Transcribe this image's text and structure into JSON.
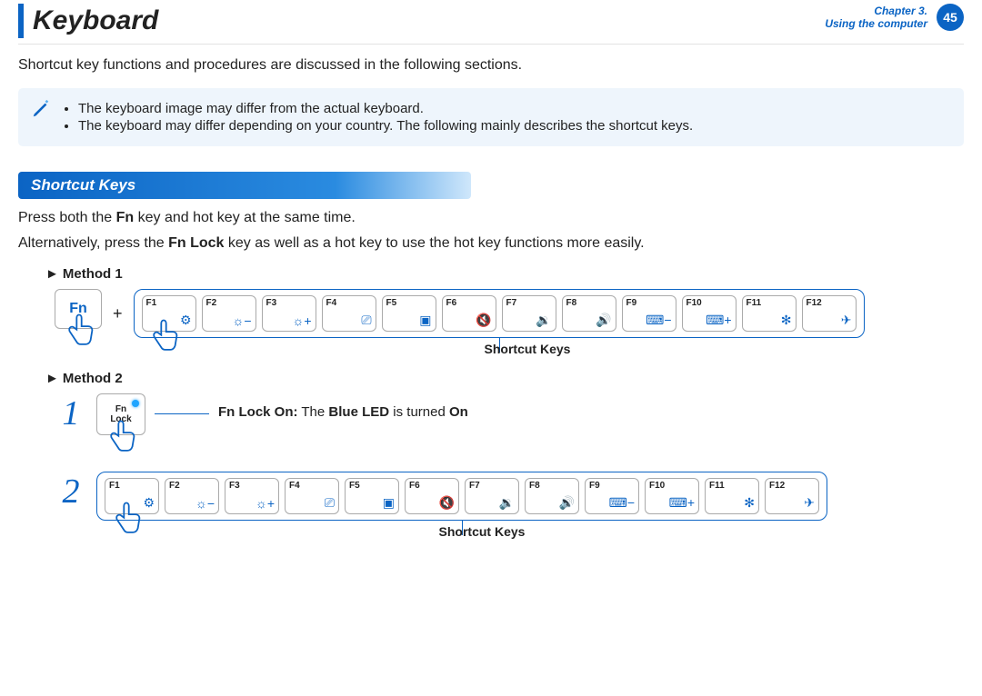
{
  "header": {
    "title": "Keyboard",
    "chapter_line": "Chapter 3.",
    "subtitle_line": "Using the computer",
    "page_number": "45"
  },
  "intro": "Shortcut key functions and procedures are discussed in the following sections.",
  "note": {
    "items": [
      "The keyboard image may differ from the actual keyboard.",
      "The keyboard may differ depending on your country. The following mainly describes the shortcut keys."
    ]
  },
  "section": {
    "heading": "Shortcut Keys",
    "desc_prefix": "Press both the ",
    "desc_bold1": "Fn",
    "desc_mid": " key and hot key at the same time.",
    "alt_prefix": "Alternatively, press the ",
    "alt_bold": "Fn Lock",
    "alt_suffix": " key as well as a hot key to use the hot key functions more easily."
  },
  "method1": {
    "label": "Method 1",
    "fn_text": "Fn",
    "plus": "+",
    "strip_caption": "Shortcut Keys"
  },
  "method2": {
    "label": "Method 2",
    "num1": "1",
    "num2": "2",
    "fnlock_text": "Fn\nLock",
    "fnlock_msg_bold1": "Fn Lock On:",
    "fnlock_msg_mid": " The ",
    "fnlock_msg_bold2": "Blue LED",
    "fnlock_msg_mid2": " is turned ",
    "fnlock_msg_bold3": "On",
    "strip_caption": "Shortcut Keys"
  },
  "fkeys": [
    {
      "label": "F1",
      "icon": "⚙"
    },
    {
      "label": "F2",
      "icon": "☼−"
    },
    {
      "label": "F3",
      "icon": "☼+"
    },
    {
      "label": "F4",
      "icon": "⎚"
    },
    {
      "label": "F5",
      "icon": "▣"
    },
    {
      "label": "F6",
      "icon": "🔇"
    },
    {
      "label": "F7",
      "icon": "🔉"
    },
    {
      "label": "F8",
      "icon": "🔊"
    },
    {
      "label": "F9",
      "icon": "⌨−"
    },
    {
      "label": "F10",
      "icon": "⌨+"
    },
    {
      "label": "F11",
      "icon": "✻"
    },
    {
      "label": "F12",
      "icon": "✈"
    }
  ]
}
